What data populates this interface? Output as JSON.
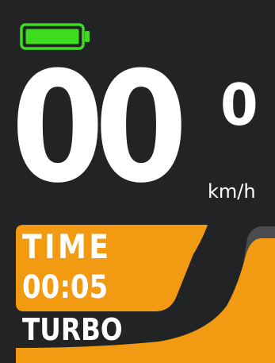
{
  "display": {
    "speed_integer": "00",
    "speed_decimal": "0",
    "unit": "km/h"
  },
  "battery": {
    "icon": "battery-icon",
    "level": 1.0,
    "color": "#3ddc1f"
  },
  "trip": {
    "label": "TIME",
    "value": "00:05"
  },
  "assist": {
    "mode": "TURBO",
    "level": 1.0
  },
  "colors": {
    "accent": "#f39a13",
    "track": "#4a4b4e",
    "text": "#ffffff",
    "background": "#222325"
  }
}
